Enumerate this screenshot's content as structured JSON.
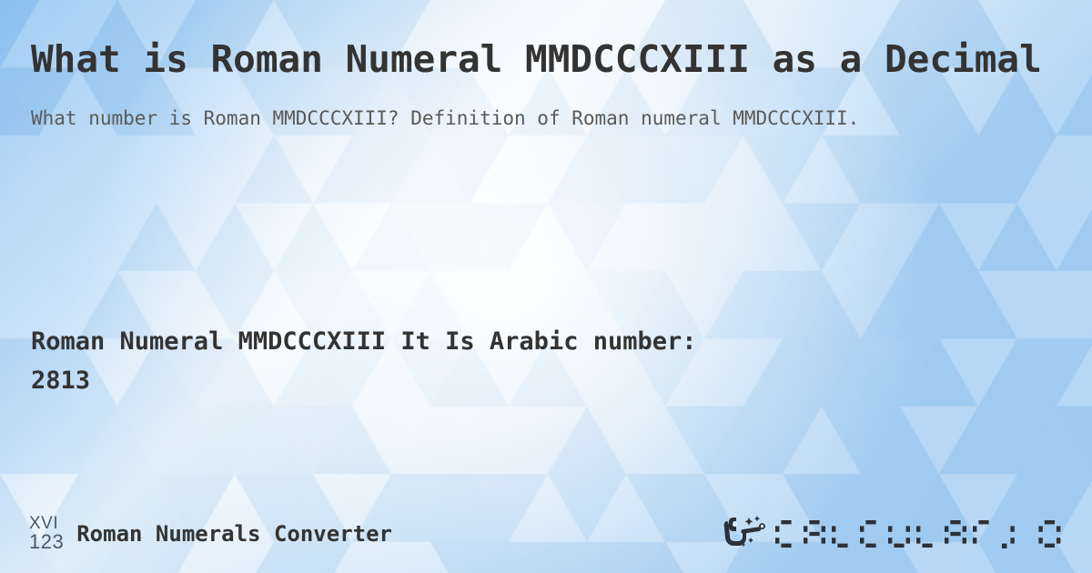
{
  "page": {
    "title": "What is Roman Numeral MMDCCCXIII as a Decimal",
    "subtitle": "What number is Roman MMDCCCXIII? Definition of Roman numeral MMDCCCXIII."
  },
  "answer": {
    "line1": "Roman Numeral MMDCCCXIII It Is  Arabic number:",
    "line2": "2813",
    "roman_numeral": "MMDCCCXIII",
    "arabic_number": "2813"
  },
  "footer": {
    "logo_top": "XVI",
    "logo_bottom": "123",
    "site_name": "Roman Numerals Converter",
    "brand": "CALCULAT.IO",
    "brand_icon": "magic-wand-hand-icon"
  },
  "theme": {
    "background_base": "#cfe4f8",
    "background_light": "#f4fafe",
    "background_accent": "#9ecbf2",
    "title_color": "#333333",
    "subtitle_color": "#5a5a5a",
    "answer_color": "#333333",
    "logo_color": "#4c5866",
    "brand_color": "#2b3138"
  }
}
